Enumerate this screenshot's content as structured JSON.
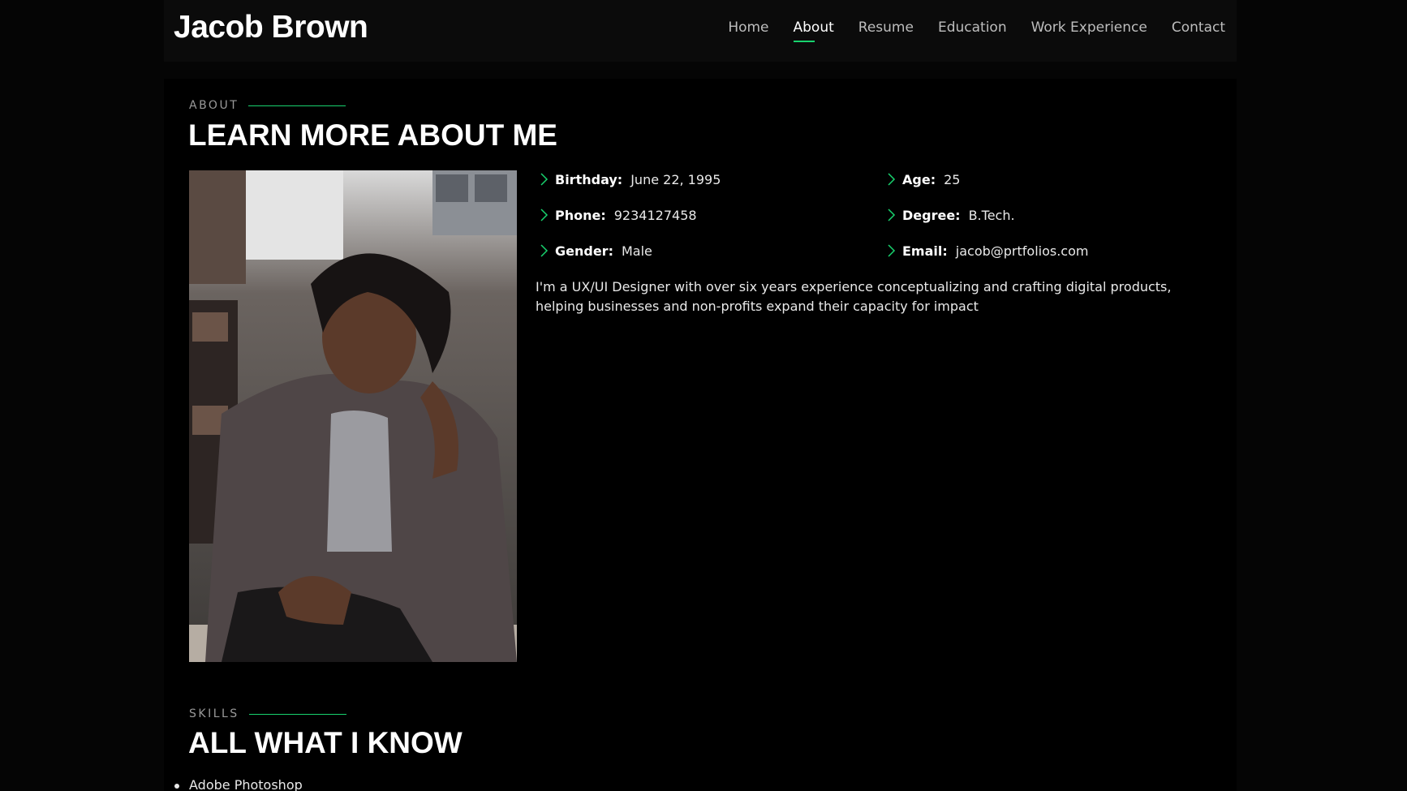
{
  "header": {
    "logo": "Jacob Brown",
    "nav": [
      {
        "label": "Home",
        "active": false
      },
      {
        "label": "About",
        "active": true
      },
      {
        "label": "Resume",
        "active": false
      },
      {
        "label": "Education",
        "active": false
      },
      {
        "label": "Work Experience",
        "active": false
      },
      {
        "label": "Contact",
        "active": false
      }
    ]
  },
  "about": {
    "label": "ABOUT",
    "title": "LEARN MORE ABOUT ME",
    "photo_alt": "Portrait of Jacob Brown",
    "details": [
      {
        "key": "Birthday:",
        "value": "June 22, 1995"
      },
      {
        "key": "Age:",
        "value": "25"
      },
      {
        "key": "Phone:",
        "value": "9234127458"
      },
      {
        "key": "Degree:",
        "value": "B.Tech."
      },
      {
        "key": "Gender:",
        "value": "Male"
      },
      {
        "key": "Email:",
        "value": "jacob@prtfolios.com"
      }
    ],
    "bio": "I'm a UX/UI Designer with over six years experience conceptualizing and crafting digital products, helping businesses and non-profits expand their capacity for impact"
  },
  "skills": {
    "label": "SKILLS",
    "title": "ALL WHAT I KNOW",
    "items": [
      "Adobe Photoshop"
    ]
  },
  "colors": {
    "accent": "#18d26e",
    "background": "#000000"
  }
}
